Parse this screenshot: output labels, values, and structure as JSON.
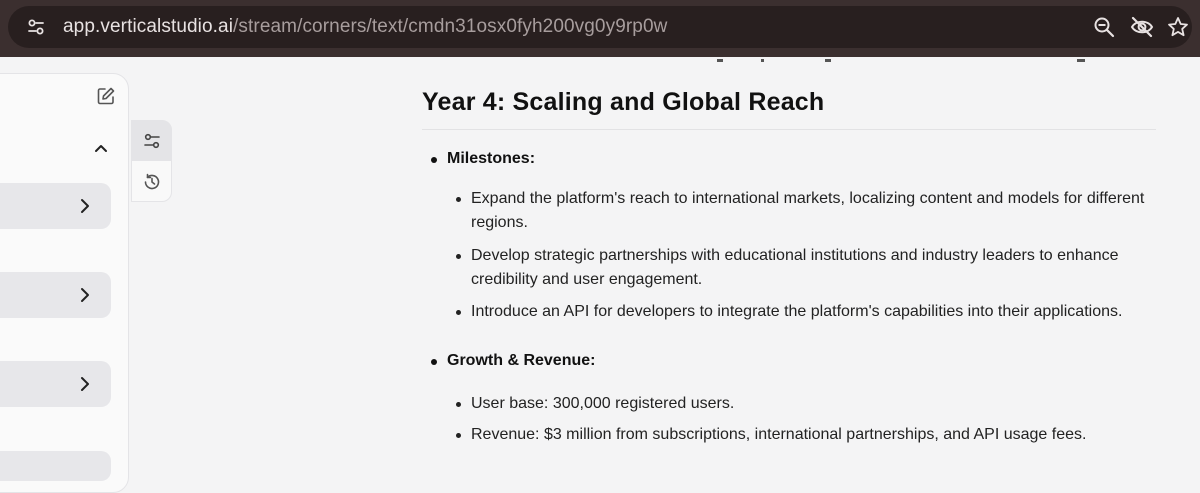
{
  "browser": {
    "url_host": "app.verticalstudio.ai",
    "url_path": "/stream/corners/text/cmdn31osx0fyh200vg0y9rp0w",
    "icons": [
      "site-info-icon",
      "zoom-out-icon",
      "eye-off-icon",
      "star-icon"
    ]
  },
  "sidebar": {
    "icons": [
      "edit-icon",
      "chevron-up-icon",
      "chevron-right-icon"
    ]
  },
  "toolrail": {
    "icons": [
      "sliders-icon",
      "history-icon"
    ]
  },
  "document": {
    "heading": "Year 4: Scaling and Global Reach",
    "sections": [
      {
        "title": "Milestones:",
        "items": [
          "Expand the platform's reach to international markets, localizing content and models for different regions.",
          "Develop strategic partnerships with educational institutions and industry leaders to enhance credibility and user engagement.",
          "Introduce an API for developers to integrate the platform's capabilities into their applications."
        ]
      },
      {
        "title": "Growth & Revenue:",
        "items": [
          "User base: 300,000 registered users.",
          "Revenue: $3 million from subscriptions, international partnerships, and API usage fees."
        ]
      }
    ]
  }
}
